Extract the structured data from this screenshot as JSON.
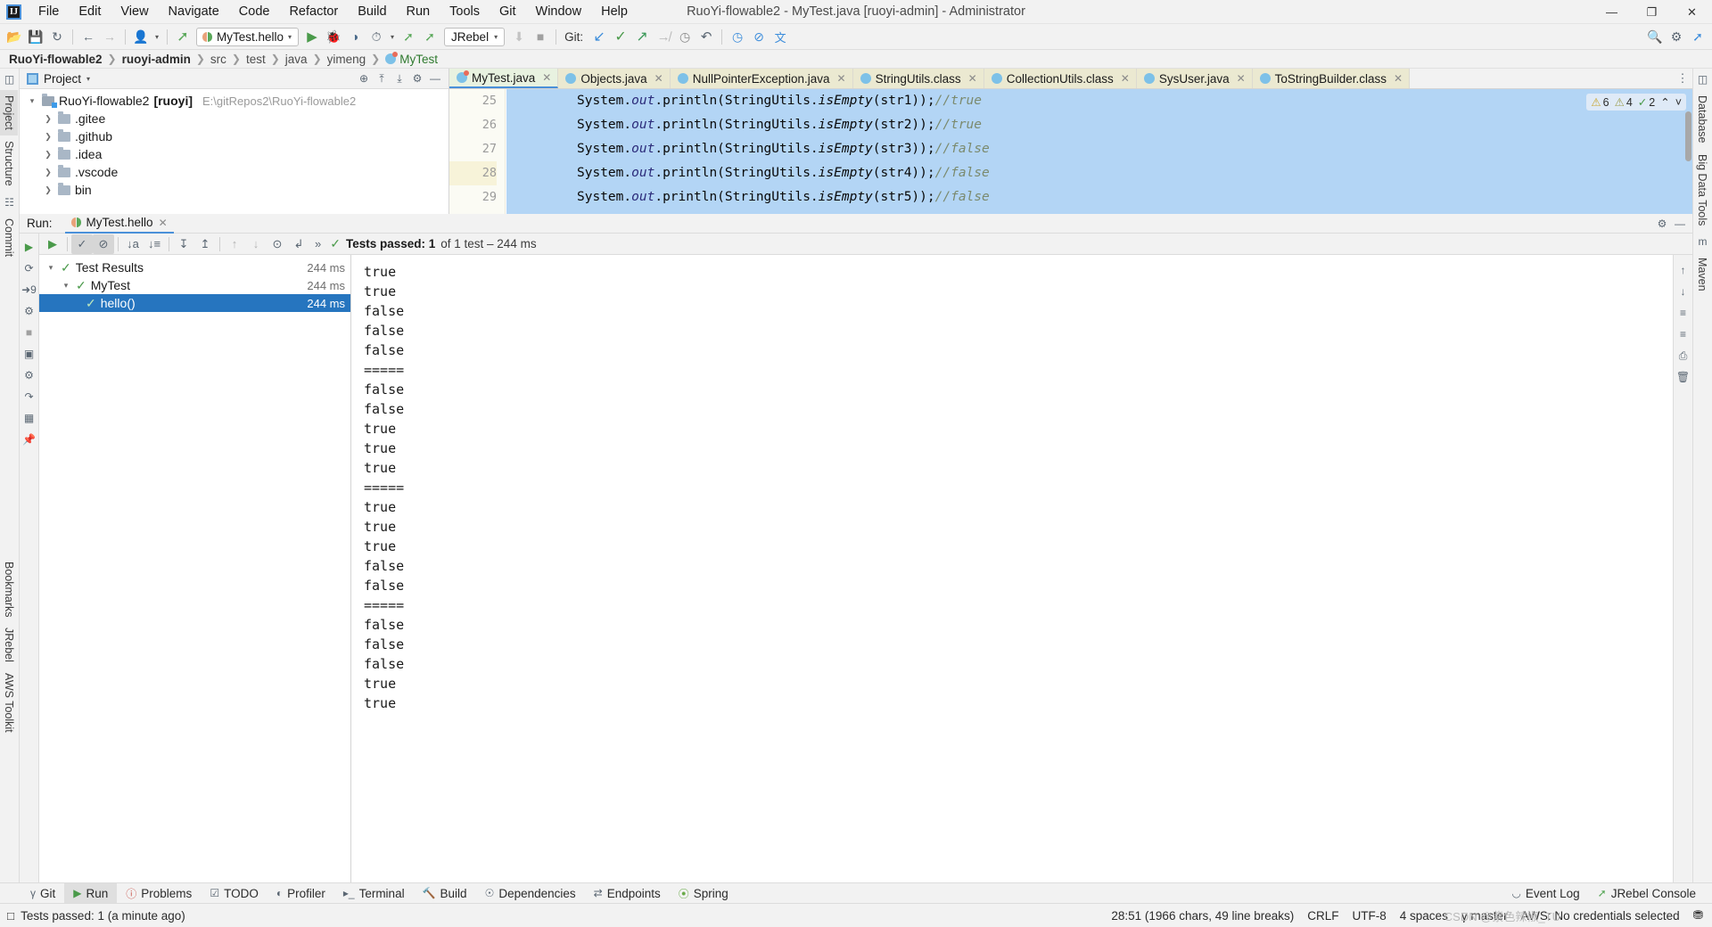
{
  "window": {
    "title": "RuoYi-flowable2 - MyTest.java [ruoyi-admin] - Administrator",
    "logo": "IJ",
    "minimize": "—",
    "maximize": "❐",
    "close": "✕"
  },
  "menu": [
    {
      "label": "File"
    },
    {
      "label": "Edit"
    },
    {
      "label": "View"
    },
    {
      "label": "Navigate"
    },
    {
      "label": "Code"
    },
    {
      "label": "Refactor"
    },
    {
      "label": "Build"
    },
    {
      "label": "Run"
    },
    {
      "label": "Tools"
    },
    {
      "label": "Git"
    },
    {
      "label": "Window"
    },
    {
      "label": "Help"
    }
  ],
  "toolbar": {
    "open_icon": "📂",
    "save_icon": "💾",
    "sync_icon": "↻",
    "back_icon": "←",
    "forward_icon": "→",
    "profile_icon": "👤",
    "build_icon": "🔨",
    "run_config": "MyTest.hello",
    "run_icon": "▶",
    "debug_icon": "🐞",
    "coverage_icon": "◑",
    "profiler_icon": "⏱",
    "jrebel_run_icon": "▶",
    "jrebel_debug_icon": "🐞",
    "jrebel_label": "JRebel",
    "attach_icon": "⬇",
    "stop_icon": "■",
    "git_label": "Git:",
    "git_update_icon": "↙",
    "git_commit_icon": "✓",
    "git_push_icon": "↗",
    "git_branch_icon": "↛",
    "git_history_icon": "◷",
    "undo_icon": "↶",
    "search_everywhere_icon": "🔍",
    "settings_icon": "⚙",
    "translate_icon": "文",
    "web_icon": "◷",
    "stop_web_icon": "⊘",
    "hammer_icon": "🔧"
  },
  "breadcrumbs": [
    {
      "label": "RuoYi-flowable2",
      "style": "bold"
    },
    {
      "label": "ruoyi-admin",
      "style": "bold"
    },
    {
      "label": "src",
      "style": "dim"
    },
    {
      "label": "test",
      "style": "dim"
    },
    {
      "label": "java",
      "style": "dim"
    },
    {
      "label": "yimeng",
      "style": "dim"
    },
    {
      "label": "MyTest",
      "style": "class"
    }
  ],
  "left_rail": [
    {
      "label": "Project",
      "icon": "project-icon",
      "selected": true
    },
    {
      "label": "Structure",
      "icon": "structure-icon",
      "selected": false
    },
    {
      "label": "Commit",
      "icon": "commit-icon",
      "selected": false
    },
    {
      "label": "Bookmarks",
      "icon": "bookmarks-icon",
      "selected": false
    },
    {
      "label": "JRebel",
      "icon": "jrebel-icon",
      "selected": false
    },
    {
      "label": "AWS Toolkit",
      "icon": "aws-icon",
      "selected": false
    }
  ],
  "right_rail": [
    {
      "label": "Database",
      "icon": "database-icon"
    },
    {
      "label": "Big Data Tools",
      "icon": "bigdata-icon"
    },
    {
      "label": "Maven",
      "icon": "maven-icon"
    }
  ],
  "project_panel": {
    "title": "Project",
    "caret": "▾",
    "locate_icon": "⊕",
    "collapse_icon": "⤓",
    "expand_icon": "⤒",
    "settings_icon": "⚙",
    "hide_icon": "—",
    "tree": [
      {
        "label": "RuoYi-flowable2",
        "badge": "[ruoyi]",
        "path": "E:\\gitRepos2\\RuoYi-flowable2",
        "depth": 0,
        "expanded": true,
        "icon": "module-folder-icon"
      },
      {
        "label": ".gitee",
        "depth": 1,
        "expanded": false,
        "icon": "folder-icon"
      },
      {
        "label": ".github",
        "depth": 1,
        "expanded": false,
        "icon": "folder-icon"
      },
      {
        "label": ".idea",
        "depth": 1,
        "expanded": false,
        "icon": "folder-icon"
      },
      {
        "label": ".vscode",
        "depth": 1,
        "expanded": false,
        "icon": "folder-icon"
      },
      {
        "label": "bin",
        "depth": 1,
        "expanded": false,
        "icon": "folder-icon"
      }
    ]
  },
  "editor": {
    "tabs": [
      {
        "label": "MyTest.java",
        "icon": "java-test-class-icon",
        "active": true
      },
      {
        "label": "Objects.java",
        "icon": "java-class-icon",
        "active": false
      },
      {
        "label": "NullPointerException.java",
        "icon": "java-class-icon",
        "active": false
      },
      {
        "label": "StringUtils.class",
        "icon": "java-class-icon",
        "active": false
      },
      {
        "label": "CollectionUtils.class",
        "icon": "java-class-icon",
        "active": false
      },
      {
        "label": "SysUser.java",
        "icon": "java-class-icon",
        "active": false
      },
      {
        "label": "ToStringBuilder.class",
        "icon": "java-class-icon",
        "active": false
      }
    ],
    "more_tabs_icon": "⋮",
    "lines": [
      {
        "no": "25",
        "obj": "System",
        "sep1": ".",
        "field": "out",
        "sep2": ".",
        "call": "println(StringUtils.",
        "mth": "isEmpty",
        "args": "(str1));",
        "comment": "//true",
        "current": false
      },
      {
        "no": "26",
        "obj": "System",
        "sep1": ".",
        "field": "out",
        "sep2": ".",
        "call": "println(StringUtils.",
        "mth": "isEmpty",
        "args": "(str2));",
        "comment": "//true",
        "current": false
      },
      {
        "no": "27",
        "obj": "System",
        "sep1": ".",
        "field": "out",
        "sep2": ".",
        "call": "println(StringUtils.",
        "mth": "isEmpty",
        "args": "(str3));",
        "comment": "//false",
        "current": false
      },
      {
        "no": "28",
        "obj": "System",
        "sep1": ".",
        "field": "out",
        "sep2": ".",
        "call": "println(StringUtils.",
        "mth": "isEmpty",
        "args": "(str4));",
        "comment": "//false",
        "current": true
      },
      {
        "no": "29",
        "obj": "System",
        "sep1": ".",
        "field": "out",
        "sep2": ".",
        "call": "println(StringUtils.",
        "mth": "isEmpty",
        "args": "(str5));",
        "comment": "//false",
        "current": false
      }
    ],
    "inspections": {
      "warning_icon": "⚠",
      "warnings": "6",
      "weak_warning_icon": "⚠",
      "weak_warnings": "4",
      "ok_icon": "✓",
      "typos": "2",
      "up_icon": "⌃",
      "down_icon": "˅"
    }
  },
  "run_panel": {
    "label": "Run:",
    "tab_label": "MyTest.hello",
    "tab_close": "✕",
    "settings_icon": "⚙",
    "hide_icon": "—",
    "side_toolbar": [
      {
        "icon": "rerun-icon",
        "name": "rerun-button"
      },
      {
        "icon": "rerun-failed-icon",
        "name": "rerun-failed-tests-button"
      },
      {
        "icon": "stop-icon",
        "name": "stop-button"
      },
      {
        "icon": "screenshot-icon",
        "name": "screenshot-button"
      },
      {
        "icon": "thread-dump-icon",
        "name": "thread-dump-button"
      },
      {
        "icon": "export-icon",
        "name": "export-button"
      },
      {
        "icon": "layout-icon",
        "name": "layout-button"
      },
      {
        "icon": "pin-icon",
        "name": "pin-tab-button"
      }
    ],
    "test_toolbar": {
      "rerun_icon": "▶",
      "show_passed_icon": "✓",
      "show_ignored_icon": "⊘",
      "sort_alpha_icon": "↓a",
      "sort_duration_icon": "↓≡",
      "expand_all_icon": "↧",
      "collapse_all_icon": "↥",
      "prev_icon": "↑",
      "next_icon": "↓",
      "history_icon": "⊙",
      "import_icon": "↲",
      "more_icon": "»"
    },
    "status": {
      "check_icon": "✓",
      "bold_text": "Tests passed: 1",
      "rest_text": "of 1 test – 244 ms"
    },
    "tree": [
      {
        "label": "Test Results",
        "ms": "244 ms",
        "depth": 0,
        "expanded": true,
        "selected": false
      },
      {
        "label": "MyTest",
        "ms": "244 ms",
        "depth": 1,
        "expanded": true,
        "selected": false
      },
      {
        "label": "hello()",
        "ms": "244 ms",
        "depth": 2,
        "expanded": false,
        "selected": true
      }
    ],
    "console_output": [
      "true",
      "true",
      "false",
      "false",
      "false",
      "=====",
      "false",
      "false",
      "true",
      "true",
      "true",
      "=====",
      "true",
      "true",
      "true",
      "false",
      "false",
      "=====",
      "false",
      "false",
      "false",
      "true",
      "true"
    ],
    "console_rail": [
      {
        "icon": "scroll-up-icon"
      },
      {
        "icon": "scroll-down-icon"
      },
      {
        "icon": "soft-wrap-icon"
      },
      {
        "icon": "filter-icon"
      },
      {
        "icon": "print-icon"
      },
      {
        "icon": "clear-all-icon"
      }
    ]
  },
  "bottom_tabs": [
    {
      "label": "Git",
      "icon": "git-branch-icon",
      "selected": false
    },
    {
      "label": "Run",
      "icon": "run-icon",
      "selected": true
    },
    {
      "label": "Problems",
      "icon": "problems-icon",
      "selected": false
    },
    {
      "label": "TODO",
      "icon": "todo-icon",
      "selected": false
    },
    {
      "label": "Profiler",
      "icon": "profiler-icon",
      "selected": false
    },
    {
      "label": "Terminal",
      "icon": "terminal-icon",
      "selected": false
    },
    {
      "label": "Build",
      "icon": "build-icon",
      "selected": false
    },
    {
      "label": "Dependencies",
      "icon": "dependencies-icon",
      "selected": false
    },
    {
      "label": "Endpoints",
      "icon": "endpoints-icon",
      "selected": false
    },
    {
      "label": "Spring",
      "icon": "spring-icon",
      "selected": false
    }
  ],
  "bottom_right": [
    {
      "label": "Event Log",
      "icon": "event-log-icon"
    },
    {
      "label": "JRebel Console",
      "icon": "jrebel-console-icon"
    }
  ],
  "statusbar": {
    "notify_icon": "□",
    "message": "Tests passed: 1 (a minute ago)",
    "caret": "28:51 (1966 chars, 49 line breaks)",
    "line_sep": "CRLF",
    "encoding": "UTF-8",
    "indent": "4 spaces",
    "branch_icon": "γ",
    "branch": "master",
    "aws": "AWS: No credentials selected",
    "db_icon": "⛃",
    "watermark": "CSDN @紫色辣椒_TU"
  },
  "colors": {
    "accent": "#4a90d9",
    "selection": "#2675bf",
    "code_selection": "#b3d5f5",
    "pass_green": "#4a9a4a",
    "tab_inactive": "#ebe9d1",
    "tab_active": "#e8f2e0"
  }
}
